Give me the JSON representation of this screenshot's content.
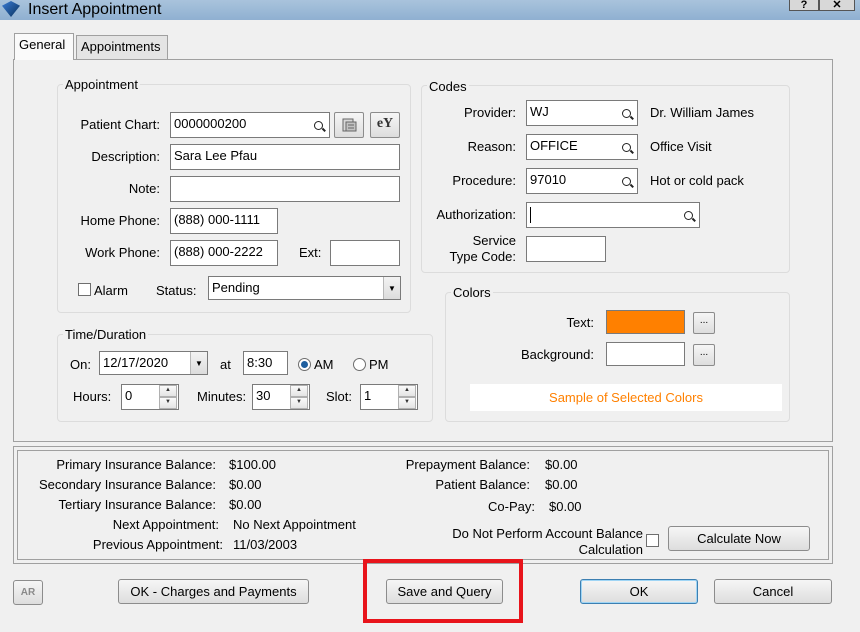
{
  "window": {
    "title": "Insert Appointment",
    "help_label": "?",
    "close_label": "✕"
  },
  "tabs": [
    {
      "label": "General"
    },
    {
      "label": "Appointments"
    }
  ],
  "appointment": {
    "group_label": "Appointment",
    "patient_chart_label": "Patient Chart:",
    "patient_chart_value": "0000000200",
    "ey_label": "eY",
    "description_label": "Description:",
    "description_value": "Sara Lee Pfau",
    "note_label": "Note:",
    "note_value": "",
    "home_phone_label": "Home Phone:",
    "home_phone_value": "(888) 000-1111",
    "work_phone_label": "Work Phone:",
    "work_phone_value": "(888) 000-2222",
    "ext_label": "Ext:",
    "ext_value": "",
    "alarm_label": "Alarm",
    "alarm_checked": false,
    "status_label": "Status:",
    "status_value": "Pending"
  },
  "codes": {
    "group_label": "Codes",
    "provider_label": "Provider:",
    "provider_value": "WJ",
    "provider_name": "Dr. William James",
    "reason_label": "Reason:",
    "reason_value": "OFFICE",
    "reason_name": "Office Visit",
    "procedure_label": "Procedure:",
    "procedure_value": "97010",
    "procedure_name": "Hot or cold pack",
    "authorization_label": "Authorization:",
    "authorization_value": "",
    "service_type_label_1": "Service",
    "service_type_label_2": "Type Code:",
    "service_type_value": ""
  },
  "colors": {
    "group_label": "Colors",
    "text_label": "Text:",
    "text_color": "#ff8000",
    "background_label": "Background:",
    "background_color": "#ffffff",
    "browse_label": "...",
    "sample_label": "Sample of Selected Colors"
  },
  "time": {
    "group_label": "Time/Duration",
    "on_label": "On:",
    "date_value": "12/17/2020",
    "at_label": "at",
    "time_value": "8:30",
    "am_label": "AM",
    "pm_label": "PM",
    "am_selected": true,
    "hours_label": "Hours:",
    "hours_value": "0",
    "minutes_label": "Minutes:",
    "minutes_value": "30",
    "slot_label": "Slot:",
    "slot_value": "1"
  },
  "balances": {
    "primary_label": "Primary Insurance Balance:",
    "primary_value": "$100.00",
    "secondary_label": "Secondary Insurance Balance:",
    "secondary_value": "$0.00",
    "tertiary_label": "Tertiary Insurance Balance:",
    "tertiary_value": "$0.00",
    "next_label": "Next Appointment:",
    "next_value": "No Next Appointment",
    "previous_label": "Previous Appointment:",
    "previous_value": "11/03/2003",
    "prepayment_label": "Prepayment Balance:",
    "prepayment_value": "$0.00",
    "patient_label": "Patient Balance:",
    "patient_value": "$0.00",
    "copay_label": "Co-Pay:",
    "copay_value": "$0.00",
    "no_calc_label_1": "Do Not Perform Account Balance",
    "no_calc_label_2": "Calculation",
    "no_calc_checked": false,
    "calculate_label": "Calculate Now"
  },
  "footer": {
    "ar_label": "AR",
    "ok_charges_label": "OK - Charges and Payments",
    "save_query_label": "Save and Query",
    "ok_label": "OK",
    "cancel_label": "Cancel"
  },
  "highlight_color": "#e8141b"
}
